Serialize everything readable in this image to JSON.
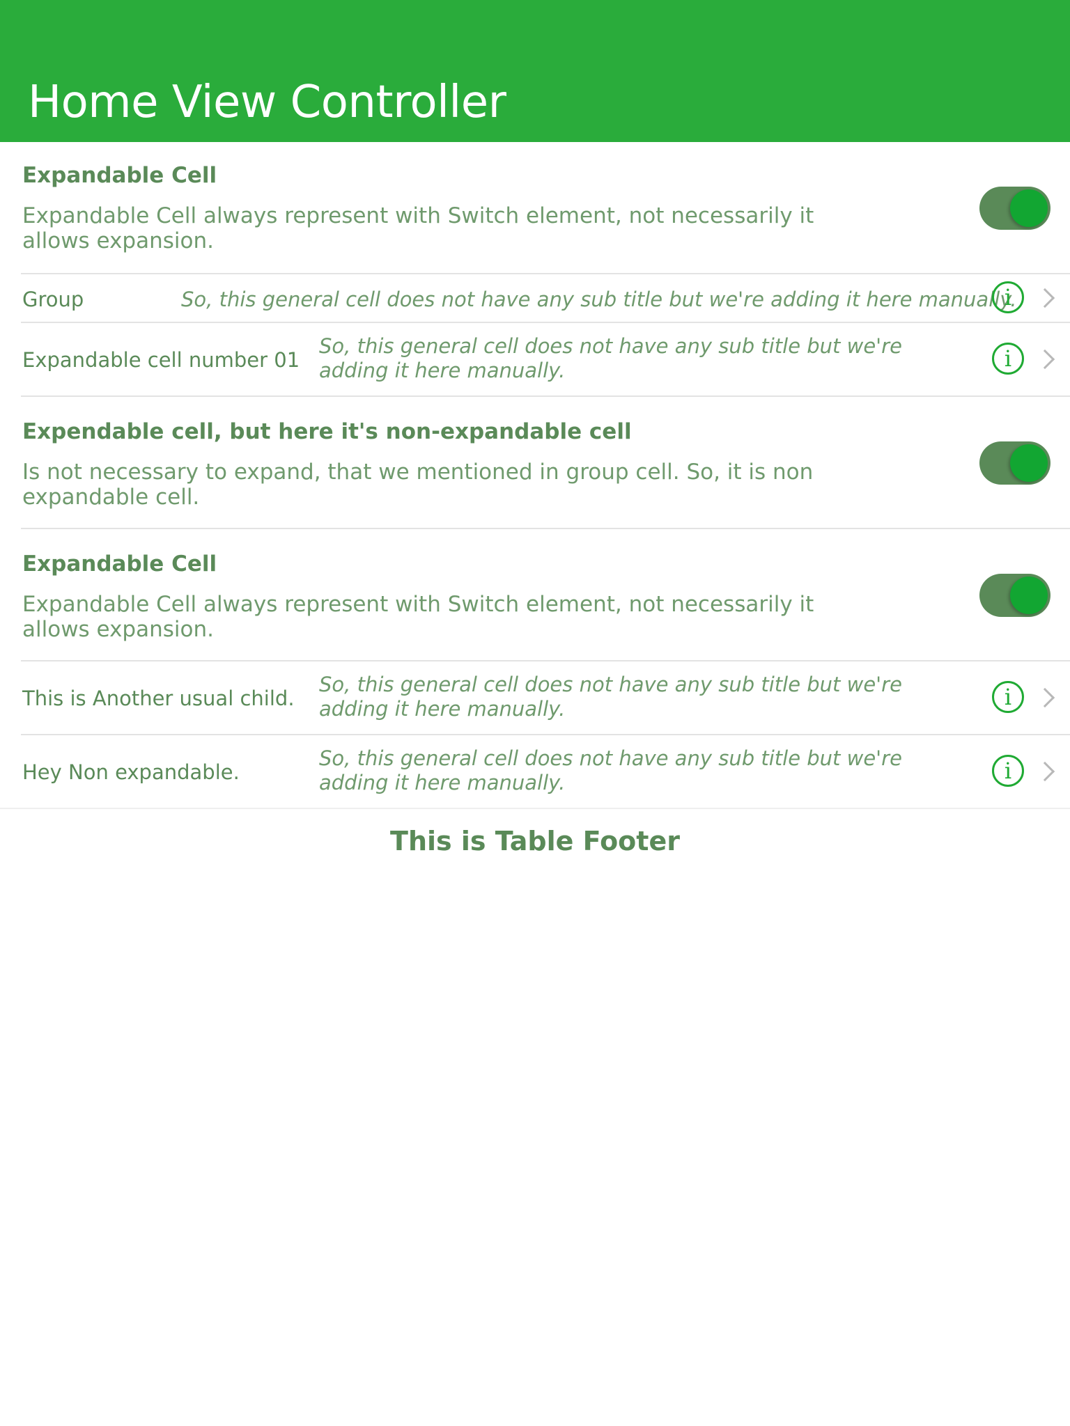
{
  "navbar": {
    "title": "Home View Controller"
  },
  "rows": [
    {
      "type": "expandable",
      "title": "Expandable Cell",
      "subtitle": "Expandable Cell always represent with Switch element, not necessarily it allows expansion.",
      "switch_on": true
    },
    {
      "type": "general",
      "title": "Group",
      "subtitle": "So, this general cell does not have any sub title but we're adding it here manually.",
      "info_icon": "info-icon",
      "disclosure_icon": "chevron-right-icon"
    },
    {
      "type": "general",
      "title": "Expandable cell number 01",
      "subtitle": "So, this general cell does not have any sub title but we're adding it here manually.",
      "info_icon": "info-icon",
      "disclosure_icon": "chevron-right-icon"
    },
    {
      "type": "expandable",
      "title": "Expendable cell, but here it's non-expandable cell",
      "subtitle": "Is not necessary to expand, that we mentioned in group cell. So, it is non expandable cell.",
      "switch_on": true
    },
    {
      "type": "expandable",
      "title": "Expandable Cell",
      "subtitle": "Expandable Cell always represent with Switch element, not necessarily it allows expansion.",
      "switch_on": true
    },
    {
      "type": "general",
      "title": "This is Another usual child.",
      "subtitle": "So, this general cell does not have any sub title but we're adding it here manually.",
      "info_icon": "info-icon",
      "disclosure_icon": "chevron-right-icon"
    },
    {
      "type": "general",
      "title": "Hey Non expandable.",
      "subtitle": "So, this general cell does not have any sub title but we're adding it here manually.",
      "info_icon": "info-icon",
      "disclosure_icon": "chevron-right-icon"
    }
  ],
  "footer": {
    "text": "This is Table Footer"
  },
  "colors": {
    "navbar": "#2aac3b",
    "text": "#5a8a58",
    "switch_track": "#5a8a58",
    "switch_knob": "#12a632",
    "info_icon": "#1faa33"
  }
}
